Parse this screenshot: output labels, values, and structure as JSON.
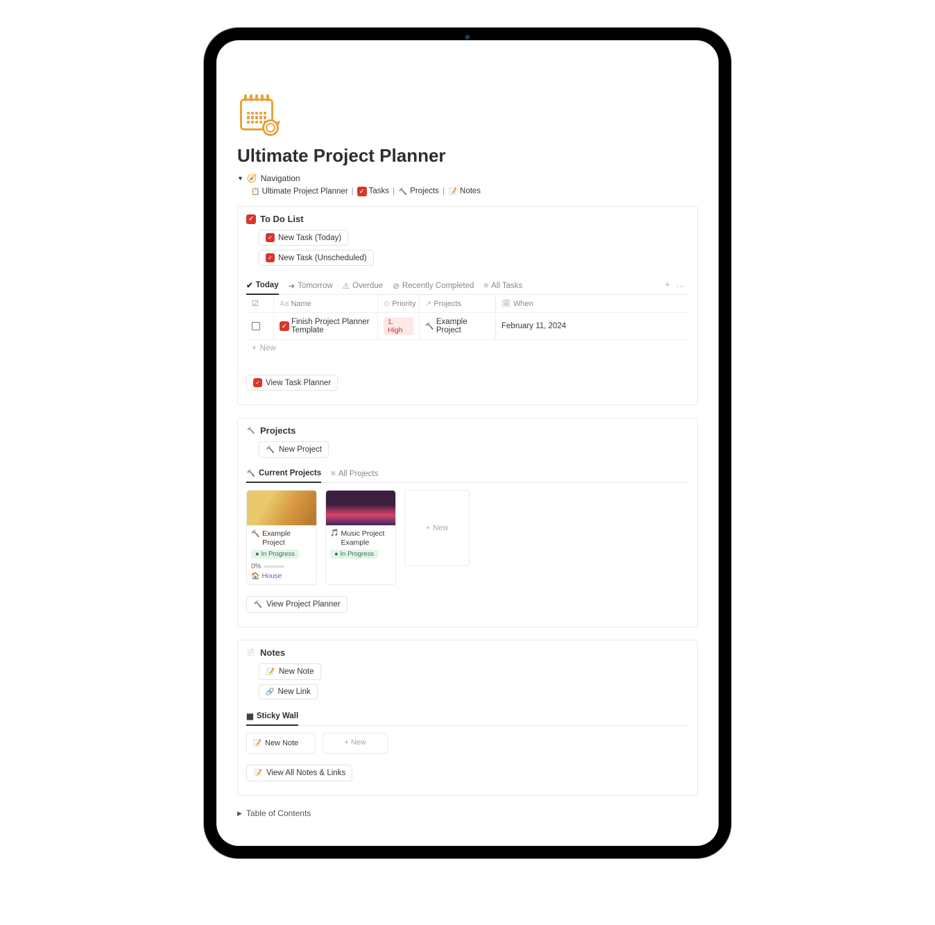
{
  "page": {
    "title": "Ultimate Project Planner"
  },
  "nav": {
    "toggle_label": "Navigation",
    "links": [
      {
        "icon": "📋",
        "label": "Ultimate Project Planner"
      },
      {
        "icon": "✅",
        "label": "Tasks"
      },
      {
        "icon": "🔨",
        "label": "Projects"
      },
      {
        "icon": "📝",
        "label": "Notes"
      }
    ]
  },
  "todo": {
    "heading": "To Do List",
    "buttons": {
      "new_today": "New Task (Today)",
      "new_unscheduled": "New Task (Unscheduled)"
    },
    "tabs": [
      "Today",
      "Tomorrow",
      "Overdue",
      "Recently Completed",
      "All Tasks"
    ],
    "columns": {
      "name": "Name",
      "priority": "Priority",
      "projects": "Projects",
      "when": "When"
    },
    "rows": [
      {
        "name": "Finish Project Planner Template",
        "priority": "1. High",
        "project": "Example Project",
        "when": "February 11, 2024"
      }
    ],
    "new_row": "New",
    "view_link": "View Task Planner"
  },
  "projects": {
    "heading": "Projects",
    "buttons": {
      "new_project": "New Project"
    },
    "tabs": [
      "Current Projects",
      "All Projects"
    ],
    "cards": [
      {
        "icon": "🔨",
        "title": "Example Project",
        "status": "In Progress",
        "progress": "0%",
        "category_icon": "🏠",
        "category": "House"
      },
      {
        "icon": "🎵",
        "title": "Music Project Example",
        "status": "In Progress"
      }
    ],
    "new_card": "New",
    "view_link": "View Project Planner"
  },
  "notes": {
    "heading": "Notes",
    "buttons": {
      "new_note": "New Note",
      "new_link": "New Link"
    },
    "tabs": [
      "Sticky Wall"
    ],
    "sticky_note": "New Note",
    "new_card": "New",
    "view_link": "View All Notes & Links"
  },
  "toc": {
    "label": "Table of Contents"
  }
}
